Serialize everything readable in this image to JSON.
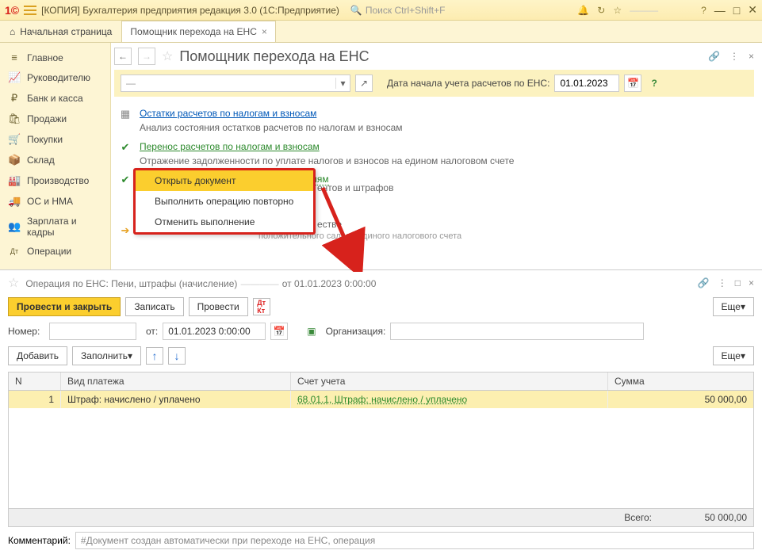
{
  "titlebar": {
    "app_title": "[КОПИЯ] Бухгалтерия предприятия         редакция 3.0  (1С:Предприятие)",
    "search_placeholder": "Поиск Ctrl+Shift+F"
  },
  "tabs": {
    "home": "Начальная страница",
    "active": "Помощник перехода на ЕНС"
  },
  "sidebar": {
    "items": [
      {
        "icon": "≡",
        "label": "Главное"
      },
      {
        "icon": "📈",
        "label": "Руководителю"
      },
      {
        "icon": "₽",
        "label": "Банк и касса"
      },
      {
        "icon": "🛍",
        "label": "Продажи"
      },
      {
        "icon": "🛒",
        "label": "Покупки"
      },
      {
        "icon": "📦",
        "label": "Склад"
      },
      {
        "icon": "🏭",
        "label": "Производство"
      },
      {
        "icon": "🚚",
        "label": "ОС и НМА"
      },
      {
        "icon": "👥",
        "label": "Зарплата и кадры"
      },
      {
        "icon": "Дт",
        "label": "Операции"
      }
    ]
  },
  "assistant": {
    "title": "Помощник перехода на ЕНС",
    "date_label": "Дата начала учета расчетов по ЕНС:",
    "date_value": "01.01.2023",
    "steps": {
      "s1_link": "Остатки расчетов по налогам и взносам",
      "s1_desc": "Анализ состояния остатков расчетов по налогам и взносам",
      "s2_link": "Перенос расчетов по налогам и взносам",
      "s2_desc": "Отражение задолженности по уплате налогов и взносов на едином налоговом счете",
      "s3_link": "Перенос расчетов по налоговым санкциям",
      "s3_tail": "ентов и штрафов",
      "s4_tail": "естве",
      "s4_desc": "положительного сальдо единого налогового счета"
    },
    "context_menu": {
      "i1": "Открыть документ",
      "i2": "Выполнить операцию повторно",
      "i3": "Отменить выполнение"
    }
  },
  "document": {
    "title_prefix": "Операция по ЕНС: Пени, штрафы (начисление)",
    "title_suffix": "от 01.01.2023 0:00:00",
    "buttons": {
      "run_close": "Провести и закрыть",
      "write": "Записать",
      "run": "Провести",
      "more": "Еще",
      "add": "Добавить",
      "fill": "Заполнить"
    },
    "labels": {
      "number": "Номер:",
      "from": "от:",
      "org": "Организация:",
      "comment": "Комментарий:"
    },
    "date_value": "01.01.2023  0:00:00",
    "table": {
      "headers": {
        "n": "N",
        "type": "Вид платежа",
        "account": "Счет учета",
        "sum": "Сумма"
      },
      "row": {
        "n": "1",
        "type": "Штраф: начислено / уплачено",
        "account": "68.01.1, Штраф: начислено / уплачено",
        "sum": "50 000,00"
      },
      "total_label": "Всего:",
      "total_value": "50 000,00"
    },
    "comment_value": "#Документ создан автоматически при переходе на ЕНС, операция"
  }
}
